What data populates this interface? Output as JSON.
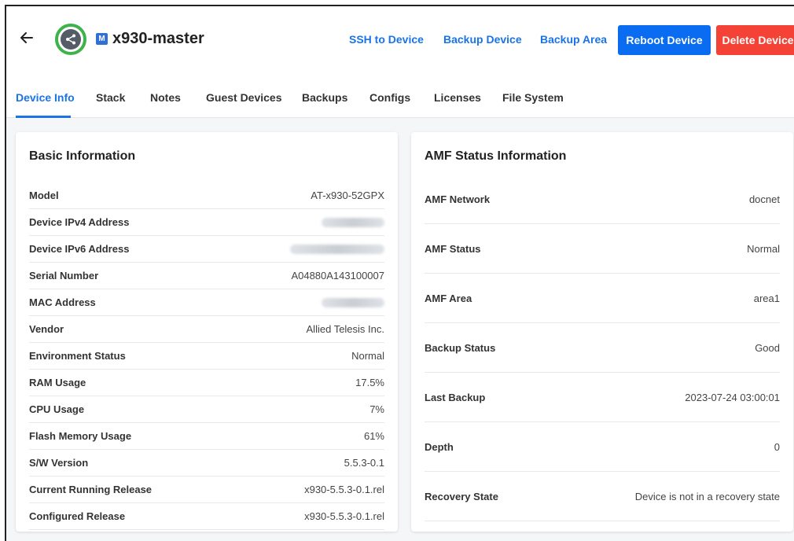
{
  "header": {
    "title": "x930-master",
    "badge": "M",
    "back_icon": "arrow-left-icon",
    "status_icon": "share-icon",
    "links": [
      "SSH to Device",
      "Backup Device",
      "Backup Area"
    ],
    "reboot_label": "Reboot Device",
    "delete_label": "Delete Device"
  },
  "tabs": [
    "Device Info",
    "Stack",
    "Notes",
    "Guest Devices",
    "Backups",
    "Configs",
    "Licenses",
    "File System"
  ],
  "basic": {
    "title": "Basic Information",
    "rows": [
      {
        "label": "Model",
        "value": "AT-x930-52GPX"
      },
      {
        "label": "Device IPv4 Address",
        "value": ""
      },
      {
        "label": "Device IPv6 Address",
        "value": ""
      },
      {
        "label": "Serial Number",
        "value": "A04880A143100007"
      },
      {
        "label": "MAC Address",
        "value": ""
      },
      {
        "label": "Vendor",
        "value": "Allied Telesis Inc."
      },
      {
        "label": "Environment Status",
        "value": "Normal"
      },
      {
        "label": "RAM Usage",
        "value": "17.5%"
      },
      {
        "label": "CPU Usage",
        "value": "7%"
      },
      {
        "label": "Flash Memory Usage",
        "value": "61%"
      },
      {
        "label": "S/W Version",
        "value": "5.5.3-0.1"
      },
      {
        "label": "Current Running Release",
        "value": "x930-5.5.3-0.1.rel"
      },
      {
        "label": "Configured Release",
        "value": "x930-5.5.3-0.1.rel"
      }
    ]
  },
  "amf": {
    "title": "AMF Status Information",
    "rows": [
      {
        "label": "AMF Network",
        "value": "docnet"
      },
      {
        "label": "AMF Status",
        "value": "Normal"
      },
      {
        "label": "AMF Area",
        "value": "area1"
      },
      {
        "label": "Backup Status",
        "value": "Good"
      },
      {
        "label": "Last Backup",
        "value": "2023-07-24 03:00:01"
      },
      {
        "label": "Depth",
        "value": "0"
      },
      {
        "label": "Recovery State",
        "value": "Device is not in a recovery state"
      }
    ]
  },
  "colors": {
    "accent": "#1a73e8",
    "reboot": "#0a6cf0",
    "delete": "#f44336",
    "status_ring": "#3eb34c"
  }
}
